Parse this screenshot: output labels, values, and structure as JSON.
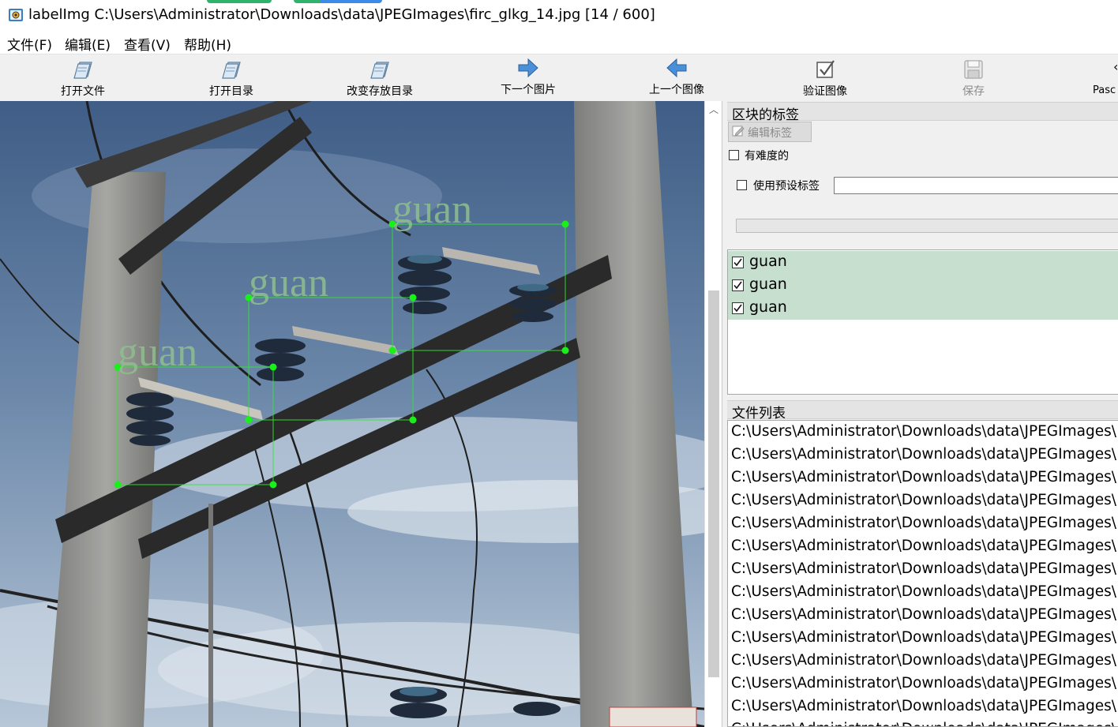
{
  "window": {
    "title": "labelImg C:\\Users\\Administrator\\Downloads\\data\\JPEGImages\\firc_glkg_14.jpg [14 / 600]",
    "app_icon": "labelimg-app-icon"
  },
  "menu": [
    {
      "label": "文件(F)"
    },
    {
      "label": "编辑(E)"
    },
    {
      "label": "查看(V)"
    },
    {
      "label": "帮助(H)"
    }
  ],
  "toolbar": [
    {
      "label": "打开文件",
      "icon": "open-file-icon",
      "enabled": true
    },
    {
      "label": "打开目录",
      "icon": "open-dir-icon",
      "enabled": true
    },
    {
      "label": "改变存放目录",
      "icon": "change-save-dir-icon",
      "enabled": true
    },
    {
      "label": "下一个图片",
      "icon": "next-image-icon",
      "enabled": true
    },
    {
      "label": "上一个图像",
      "icon": "prev-image-icon",
      "enabled": true
    },
    {
      "label": "验证图像",
      "icon": "verify-image-icon",
      "enabled": true
    },
    {
      "label": "保存",
      "icon": "save-icon",
      "enabled": false
    },
    {
      "label": "Pasc",
      "icon": "format-toggle-icon",
      "enabled": true
    }
  ],
  "canvas": {
    "boxes": [
      {
        "label": "guan"
      },
      {
        "label": "guan"
      },
      {
        "label": "guan"
      }
    ],
    "box_color": "#2ee82e",
    "label_text_color": "#8fbf8f"
  },
  "right_panel": {
    "box_labels_title": "区块的标签",
    "edit_label_button": "编辑标签",
    "difficult_label": "有难度的",
    "use_default_label": "使用预设标签",
    "default_label_value": "",
    "labels": [
      {
        "text": "guan",
        "checked": true
      },
      {
        "text": "guan",
        "checked": true
      },
      {
        "text": "guan",
        "checked": true
      }
    ],
    "label_highlight_color": "#c6dfcf",
    "file_list_title": "文件列表",
    "files": [
      "C:\\Users\\Administrator\\Downloads\\data\\JPEGImages\\",
      "C:\\Users\\Administrator\\Downloads\\data\\JPEGImages\\",
      "C:\\Users\\Administrator\\Downloads\\data\\JPEGImages\\",
      "C:\\Users\\Administrator\\Downloads\\data\\JPEGImages\\",
      "C:\\Users\\Administrator\\Downloads\\data\\JPEGImages\\",
      "C:\\Users\\Administrator\\Downloads\\data\\JPEGImages\\",
      "C:\\Users\\Administrator\\Downloads\\data\\JPEGImages\\",
      "C:\\Users\\Administrator\\Downloads\\data\\JPEGImages\\",
      "C:\\Users\\Administrator\\Downloads\\data\\JPEGImages\\",
      "C:\\Users\\Administrator\\Downloads\\data\\JPEGImages\\",
      "C:\\Users\\Administrator\\Downloads\\data\\JPEGImages\\",
      "C:\\Users\\Administrator\\Downloads\\data\\JPEGImages\\",
      "C:\\Users\\Administrator\\Downloads\\data\\JPEGImages\\",
      "C:\\Users\\Administrator\\Downloads\\data\\JPEGImages\\"
    ]
  }
}
